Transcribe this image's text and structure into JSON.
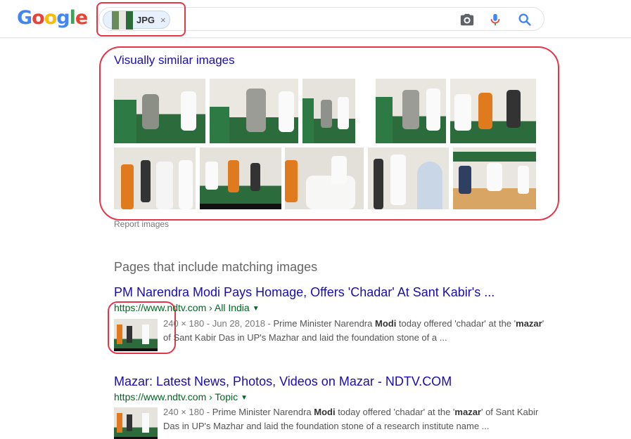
{
  "logo": {
    "text": "Google",
    "letters": [
      "G",
      "o",
      "o",
      "g",
      "l",
      "e"
    ]
  },
  "search": {
    "chip_label": "JPG",
    "chip_close": "×"
  },
  "similar": {
    "title": "Visually similar images",
    "report_label": "Report images"
  },
  "pages_heading": "Pages that include matching images",
  "results": [
    {
      "title": "PM Narendra Modi Pays Homage, Offers 'Chadar' At Sant Kabir's ...",
      "url": "https://www.ndtv.com › All India",
      "meta": "240 × 180 - Jun 28, 2018 -",
      "snippet_a": " Prime Minister Narendra ",
      "bold1": "Modi",
      "snippet_b": " today offered 'chadar' at the '",
      "bold2": "mazar",
      "snippet_c": "' of Sant Kabir Das in UP's Mazhar and laid the foundation stone of a ..."
    },
    {
      "title": "Mazar: Latest News, Photos, Videos on Mazar - NDTV.COM",
      "url": "https://www.ndtv.com › Topic",
      "meta": "240 × 180 -",
      "snippet_a": " Prime Minister Narendra ",
      "bold1": "Modi",
      "snippet_b": " today offered 'chadar' at the '",
      "bold2": "mazar",
      "snippet_c": "' of Sant Kabir Das in UP's Mazhar and laid the foundation stone of a research institute name ..."
    }
  ],
  "colors": {
    "link": "#1a0dab",
    "url": "#006621",
    "annotation": "#e2374a"
  }
}
